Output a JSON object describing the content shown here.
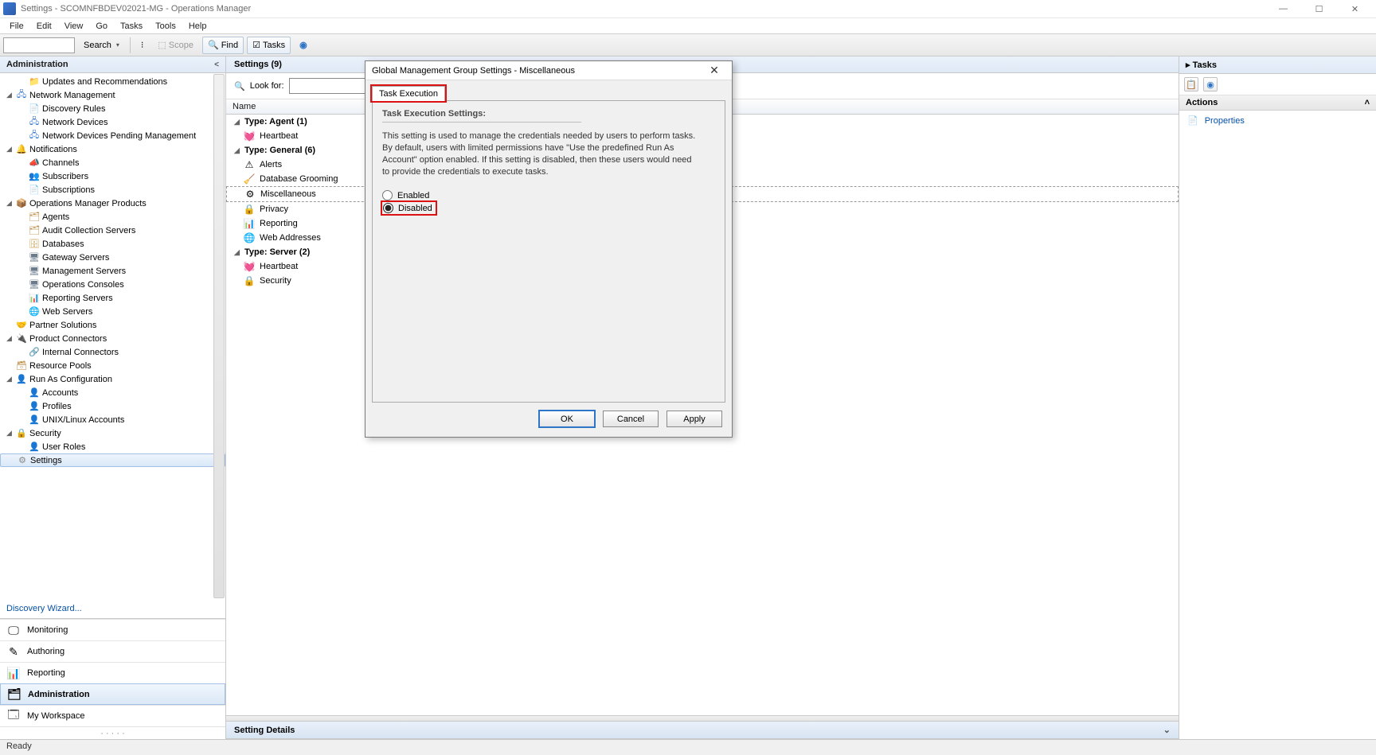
{
  "window": {
    "title": "Settings - SCOMNFBDEV02021-MG - Operations Manager"
  },
  "menu": {
    "items": [
      "File",
      "Edit",
      "View",
      "Go",
      "Tasks",
      "Tools",
      "Help"
    ]
  },
  "toolbar": {
    "search_placeholder": "",
    "search_label": "Search",
    "scope": "Scope",
    "find": "Find",
    "tasks": "Tasks"
  },
  "nav": {
    "header": "Administration",
    "tree": [
      {
        "lvl": 1,
        "tw": "",
        "ic": "📁",
        "cls": "folder",
        "label": "Updates and Recommendations"
      },
      {
        "lvl": 0,
        "tw": "◢",
        "ic": "🖧",
        "cls": "net",
        "label": "Network Management"
      },
      {
        "lvl": 1,
        "tw": "",
        "ic": "📄",
        "cls": "blue",
        "label": "Discovery Rules"
      },
      {
        "lvl": 1,
        "tw": "",
        "ic": "🖧",
        "cls": "net",
        "label": "Network Devices"
      },
      {
        "lvl": 1,
        "tw": "",
        "ic": "🖧",
        "cls": "net",
        "label": "Network Devices Pending Management"
      },
      {
        "lvl": 0,
        "tw": "◢",
        "ic": "🔔",
        "cls": "bell",
        "label": "Notifications"
      },
      {
        "lvl": 1,
        "tw": "",
        "ic": "📣",
        "cls": "bell",
        "label": "Channels"
      },
      {
        "lvl": 1,
        "tw": "",
        "ic": "👥",
        "cls": "ppl",
        "label": "Subscribers"
      },
      {
        "lvl": 1,
        "tw": "",
        "ic": "📄",
        "cls": "blue",
        "label": "Subscriptions"
      },
      {
        "lvl": 0,
        "tw": "◢",
        "ic": "📦",
        "cls": "pkg",
        "label": "Operations Manager Products"
      },
      {
        "lvl": 1,
        "tw": "",
        "ic": "🗂",
        "cls": "pkg",
        "label": "Agents"
      },
      {
        "lvl": 1,
        "tw": "",
        "ic": "🗂",
        "cls": "pkg",
        "label": "Audit Collection Servers"
      },
      {
        "lvl": 1,
        "tw": "",
        "ic": "🗄",
        "cls": "db",
        "label": "Databases"
      },
      {
        "lvl": 1,
        "tw": "",
        "ic": "🖥",
        "cls": "srv",
        "label": "Gateway Servers"
      },
      {
        "lvl": 1,
        "tw": "",
        "ic": "🖥",
        "cls": "srv",
        "label": "Management Servers"
      },
      {
        "lvl": 1,
        "tw": "",
        "ic": "🖥",
        "cls": "srv",
        "label": "Operations Consoles"
      },
      {
        "lvl": 1,
        "tw": "",
        "ic": "📊",
        "cls": "blue",
        "label": "Reporting Servers"
      },
      {
        "lvl": 1,
        "tw": "",
        "ic": "🌐",
        "cls": "blue",
        "label": "Web Servers"
      },
      {
        "lvl": 0,
        "tw": "",
        "ic": "🤝",
        "cls": "bell",
        "label": "Partner Solutions"
      },
      {
        "lvl": 0,
        "tw": "◢",
        "ic": "🔌",
        "cls": "gear",
        "label": "Product Connectors"
      },
      {
        "lvl": 1,
        "tw": "",
        "ic": "🔗",
        "cls": "gear",
        "label": "Internal Connectors"
      },
      {
        "lvl": 0,
        "tw": "",
        "ic": "🗃",
        "cls": "pkg",
        "label": "Resource Pools"
      },
      {
        "lvl": 0,
        "tw": "◢",
        "ic": "👤",
        "cls": "ppl",
        "label": "Run As Configuration"
      },
      {
        "lvl": 1,
        "tw": "",
        "ic": "👤",
        "cls": "ppl",
        "label": "Accounts"
      },
      {
        "lvl": 1,
        "tw": "",
        "ic": "👤",
        "cls": "ppl",
        "label": "Profiles"
      },
      {
        "lvl": 1,
        "tw": "",
        "ic": "👤",
        "cls": "ppl",
        "label": "UNIX/Linux Accounts"
      },
      {
        "lvl": 0,
        "tw": "◢",
        "ic": "🔒",
        "cls": "sec",
        "label": "Security"
      },
      {
        "lvl": 1,
        "tw": "",
        "ic": "👤",
        "cls": "ppl",
        "label": "User Roles"
      },
      {
        "lvl": 0,
        "tw": "",
        "ic": "⚙",
        "cls": "gear",
        "label": "Settings",
        "sel": true
      }
    ],
    "wizard_link": "Discovery Wizard...",
    "wunderbar": [
      {
        "icon": "🖵",
        "label": "Monitoring"
      },
      {
        "icon": "✎",
        "label": "Authoring"
      },
      {
        "icon": "📊",
        "label": "Reporting"
      },
      {
        "icon": "🗂",
        "label": "Administration",
        "active": true
      },
      {
        "icon": "🗔",
        "label": "My Workspace"
      }
    ]
  },
  "list": {
    "header": "Settings (9)",
    "lookfor_label": "Look for:",
    "column": "Name",
    "groups": [
      {
        "title": "Type: Agent (1)",
        "items": [
          {
            "ic": "💓",
            "label": "Heartbeat"
          }
        ]
      },
      {
        "title": "Type: General (6)",
        "items": [
          {
            "ic": "⚠",
            "label": "Alerts"
          },
          {
            "ic": "🧹",
            "label": "Database Grooming"
          },
          {
            "ic": "⚙",
            "label": "Miscellaneous",
            "sel": true
          },
          {
            "ic": "🔒",
            "label": "Privacy"
          },
          {
            "ic": "📊",
            "label": "Reporting"
          },
          {
            "ic": "🌐",
            "label": "Web Addresses"
          }
        ]
      },
      {
        "title": "Type: Server (2)",
        "items": [
          {
            "ic": "💓",
            "label": "Heartbeat"
          },
          {
            "ic": "🔒",
            "label": "Security"
          }
        ]
      }
    ],
    "details_header": "Setting Details"
  },
  "tasks": {
    "header": "Tasks",
    "actions_header": "Actions",
    "action_items": [
      "Properties"
    ]
  },
  "dialog": {
    "title": "Global Management Group Settings - Miscellaneous",
    "tab": "Task Execution",
    "section_title": "Task Execution Settings:",
    "description": "This setting is used to manage the credentials needed by users to perform tasks. By default, users with limited permissions have \"Use the predefined Run As Account\" option enabled. If this setting is disabled, then these users would need to provide the credentials to execute tasks.",
    "radio_enabled": "Enabled",
    "radio_disabled": "Disabled",
    "ok": "OK",
    "cancel": "Cancel",
    "apply": "Apply"
  },
  "status": {
    "text": "Ready"
  }
}
